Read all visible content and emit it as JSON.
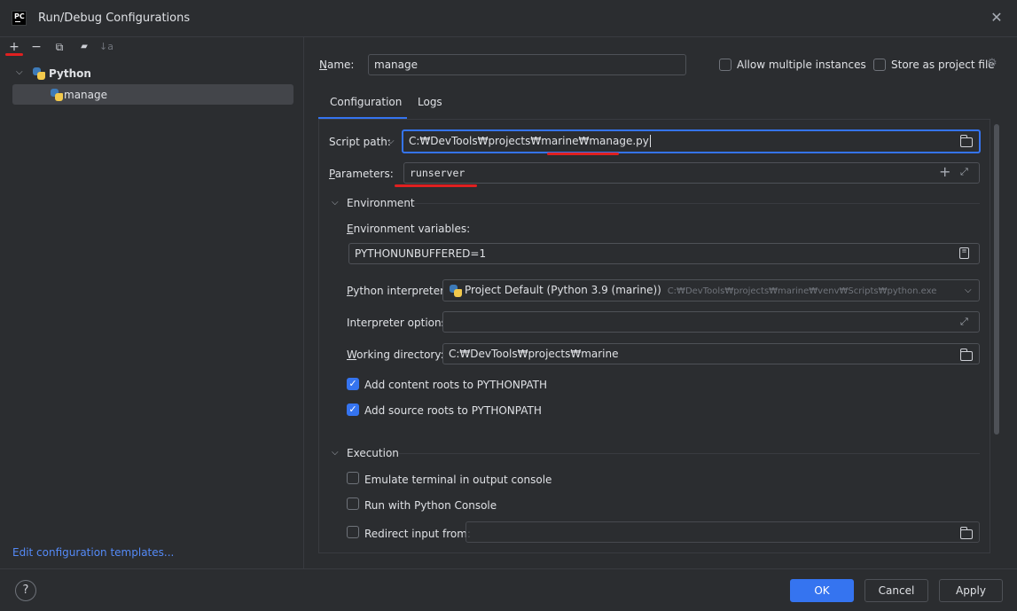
{
  "window": {
    "title": "Run/Debug Configurations",
    "logo_text": "PC"
  },
  "toolbar": {
    "add": "+",
    "remove": "−",
    "copy": "⧉",
    "folder": "▰",
    "sort": "↓a"
  },
  "tree": {
    "group_label": "Python",
    "item_label": "manage"
  },
  "edit_templates_link": "Edit configuration templates...",
  "name_row": {
    "label": "Name:",
    "value": "manage",
    "allow_multiple_label": "Allow multiple instances",
    "allow_multiple_checked": false,
    "store_as_file_label": "Store as project file",
    "store_as_file_checked": false
  },
  "tabs": [
    "Configuration",
    "Logs"
  ],
  "script_path": {
    "label": "Script path:",
    "value": "C:₩DevTools₩projects₩marine₩manage.py"
  },
  "parameters": {
    "label": "Parameters:",
    "value": "runserver"
  },
  "environment": {
    "section_label": "Environment",
    "env_vars_label": "Environment variables:",
    "env_vars_value": "PYTHONUNBUFFERED=1",
    "interpreter_label": "Python interpreter:",
    "interpreter_value": "Project Default (Python 3.9 (marine))",
    "interpreter_path": "C:₩DevTools₩projects₩marine₩venv₩Scripts₩python.exe",
    "interp_options_label": "Interpreter options:",
    "interp_options_value": "",
    "working_dir_label": "Working directory:",
    "working_dir_value": "C:₩DevTools₩projects₩marine",
    "content_roots_label": "Add content roots to PYTHONPATH",
    "content_roots_checked": true,
    "source_roots_label": "Add source roots to PYTHONPATH",
    "source_roots_checked": true
  },
  "execution": {
    "section_label": "Execution",
    "emulate_terminal_label": "Emulate terminal in output console",
    "emulate_terminal_checked": false,
    "python_console_label": "Run with Python Console",
    "python_console_checked": false,
    "redirect_input_label": "Redirect input from:",
    "redirect_input_checked": false,
    "redirect_input_value": ""
  },
  "buttons": {
    "help": "?",
    "ok": "OK",
    "cancel": "Cancel",
    "apply": "Apply"
  },
  "colors": {
    "accent": "#3574f0",
    "background": "#2b2d30",
    "annotation_red": "#e02020",
    "link": "#548af7"
  }
}
